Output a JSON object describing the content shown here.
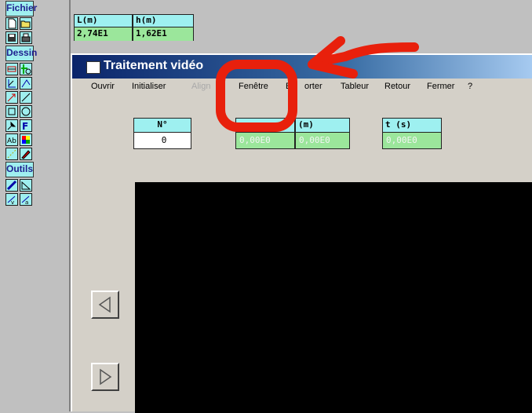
{
  "toolbar": {
    "fichier_label": "Fichier",
    "dessin_label": "Dessin",
    "outils_label": "Outils",
    "fill_color": "#9fefef",
    "header_text_color": "#1f1f8f"
  },
  "readouts": [
    {
      "label": "L(m)",
      "value": "2,74E1"
    },
    {
      "label": "h(m)",
      "value": "1,62E1"
    }
  ],
  "window": {
    "title": "Traitement vidéo",
    "title_bar_color": "#0a246a"
  },
  "menu": {
    "items": [
      {
        "label": "Ouvrir",
        "enabled": true
      },
      {
        "label": "Initialiser",
        "enabled": true
      },
      {
        "label": "Align",
        "enabled": false
      },
      {
        "label": "Fenêtre",
        "enabled": true
      },
      {
        "label": "E",
        "enabled": true
      },
      {
        "label": "orter",
        "enabled": true
      },
      {
        "label": "Tableur",
        "enabled": true
      },
      {
        "label": "Retour",
        "enabled": true
      },
      {
        "label": "Fermer",
        "enabled": true
      },
      {
        "label": "?",
        "enabled": true
      }
    ]
  },
  "fields": {
    "n": {
      "label": "N°",
      "value": "0"
    },
    "x": {
      "label": "",
      "value": "0,00E0"
    },
    "y": {
      "label": "(m)",
      "value": "0,00E0"
    },
    "t": {
      "label": "t (s)",
      "value": "0,00E0"
    }
  },
  "annotation_color": "#e8200c"
}
